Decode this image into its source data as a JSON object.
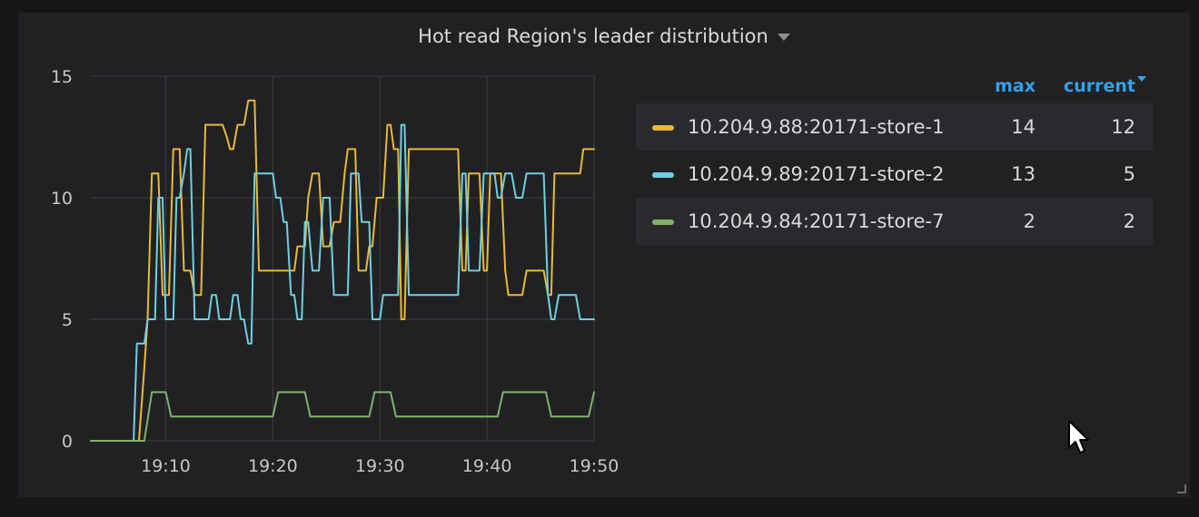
{
  "panel": {
    "title": "Hot read Region's leader distribution"
  },
  "legend": {
    "columns": {
      "max": "max",
      "current": "current"
    },
    "rows": [
      {
        "name": "10.204.9.88:20171-store-1",
        "max": "14",
        "current": "12",
        "color": "#eab839"
      },
      {
        "name": "10.204.9.89:20171-store-2",
        "max": "13",
        "current": "5",
        "color": "#6ed0e0"
      },
      {
        "name": "10.204.9.84:20171-store-7",
        "max": "2",
        "current": "2",
        "color": "#7eb26d"
      }
    ]
  },
  "chart_data": {
    "type": "line",
    "x_unit": "minutes (19:xx)",
    "xlim": [
      3,
      50
    ],
    "ylim": [
      0,
      15
    ],
    "x_ticks": [
      {
        "value": 10,
        "label": "19:10"
      },
      {
        "value": 20,
        "label": "19:20"
      },
      {
        "value": 30,
        "label": "19:30"
      },
      {
        "value": 40,
        "label": "19:40"
      },
      {
        "value": 50,
        "label": "19:50"
      }
    ],
    "y_ticks": [
      {
        "value": 0,
        "label": "0"
      },
      {
        "value": 5,
        "label": "5"
      },
      {
        "value": 10,
        "label": "10"
      },
      {
        "value": 15,
        "label": "15"
      }
    ],
    "grid": true,
    "series": [
      {
        "name": "10.204.9.88:20171-store-1",
        "color": "#eab839",
        "points": [
          [
            3,
            0
          ],
          [
            7,
            0
          ],
          [
            7.5,
            0
          ],
          [
            8,
            3
          ],
          [
            8.3,
            5
          ],
          [
            8.7,
            11
          ],
          [
            9,
            11
          ],
          [
            9.3,
            11
          ],
          [
            9.7,
            6
          ],
          [
            10,
            6
          ],
          [
            10.3,
            6
          ],
          [
            10.7,
            12
          ],
          [
            11,
            12
          ],
          [
            11.3,
            12
          ],
          [
            11.7,
            7
          ],
          [
            12,
            7
          ],
          [
            12.3,
            7
          ],
          [
            12.7,
            6
          ],
          [
            13,
            6
          ],
          [
            13.3,
            6
          ],
          [
            13.7,
            13
          ],
          [
            14,
            13
          ],
          [
            14.3,
            13
          ],
          [
            14.7,
            13
          ],
          [
            15,
            13
          ],
          [
            15.3,
            13
          ],
          [
            15.7,
            12.5
          ],
          [
            16,
            12
          ],
          [
            16.3,
            12
          ],
          [
            16.7,
            13
          ],
          [
            17,
            13
          ],
          [
            17.3,
            13
          ],
          [
            17.7,
            14
          ],
          [
            18,
            14
          ],
          [
            18.3,
            14
          ],
          [
            18.7,
            7
          ],
          [
            19,
            7
          ],
          [
            19.3,
            7
          ],
          [
            19.7,
            7
          ],
          [
            20,
            7
          ],
          [
            20.3,
            7
          ],
          [
            20.7,
            7
          ],
          [
            21,
            7
          ],
          [
            21.3,
            7
          ],
          [
            21.7,
            7
          ],
          [
            22,
            7
          ],
          [
            22.3,
            8
          ],
          [
            22.7,
            8
          ],
          [
            23,
            8
          ],
          [
            23.3,
            10
          ],
          [
            23.7,
            11
          ],
          [
            24,
            11
          ],
          [
            24.3,
            11
          ],
          [
            24.7,
            8
          ],
          [
            25,
            8
          ],
          [
            25.3,
            8
          ],
          [
            25.7,
            9
          ],
          [
            26,
            9
          ],
          [
            26.3,
            9
          ],
          [
            26.7,
            11
          ],
          [
            27,
            12
          ],
          [
            27.3,
            12
          ],
          [
            27.7,
            12
          ],
          [
            28,
            7
          ],
          [
            28.3,
            7
          ],
          [
            28.7,
            7
          ],
          [
            29,
            8
          ],
          [
            29.3,
            8
          ],
          [
            29.7,
            10
          ],
          [
            30,
            10
          ],
          [
            30.3,
            10
          ],
          [
            30.7,
            13
          ],
          [
            31,
            13
          ],
          [
            31.3,
            12
          ],
          [
            31.7,
            12
          ],
          [
            32,
            5
          ],
          [
            32.3,
            5
          ],
          [
            32.7,
            12
          ],
          [
            33,
            12
          ],
          [
            33.3,
            12
          ],
          [
            33.7,
            12
          ],
          [
            34,
            12
          ],
          [
            34.3,
            12
          ],
          [
            34.7,
            12
          ],
          [
            35,
            12
          ],
          [
            35.3,
            12
          ],
          [
            35.7,
            12
          ],
          [
            36,
            12
          ],
          [
            36.3,
            12
          ],
          [
            36.7,
            12
          ],
          [
            37,
            12
          ],
          [
            37.3,
            12
          ],
          [
            37.7,
            7
          ],
          [
            38,
            7
          ],
          [
            38.3,
            11
          ],
          [
            38.7,
            11
          ],
          [
            39,
            11
          ],
          [
            39.3,
            11
          ],
          [
            39.7,
            7
          ],
          [
            40,
            7
          ],
          [
            40.3,
            11
          ],
          [
            40.7,
            11
          ],
          [
            41,
            11
          ],
          [
            41.3,
            11
          ],
          [
            41.7,
            7
          ],
          [
            42,
            6
          ],
          [
            42.3,
            6
          ],
          [
            42.7,
            6
          ],
          [
            43,
            6
          ],
          [
            43.3,
            6
          ],
          [
            43.7,
            7
          ],
          [
            44,
            7
          ],
          [
            44.3,
            7
          ],
          [
            44.7,
            7
          ],
          [
            45,
            7
          ],
          [
            45.3,
            7
          ],
          [
            45.7,
            6
          ],
          [
            46,
            6
          ],
          [
            46.3,
            11
          ],
          [
            46.7,
            11
          ],
          [
            47,
            11
          ],
          [
            47.3,
            11
          ],
          [
            47.7,
            11
          ],
          [
            48,
            11
          ],
          [
            48.3,
            11
          ],
          [
            48.7,
            11
          ],
          [
            49,
            12
          ],
          [
            49.3,
            12
          ],
          [
            49.7,
            12
          ],
          [
            50,
            12
          ]
        ]
      },
      {
        "name": "10.204.9.89:20171-store-2",
        "color": "#6ed0e0",
        "points": [
          [
            3,
            0
          ],
          [
            7,
            0
          ],
          [
            7.3,
            4
          ],
          [
            7.7,
            4
          ],
          [
            8,
            4
          ],
          [
            8.3,
            5
          ],
          [
            8.7,
            5
          ],
          [
            9,
            5
          ],
          [
            9.3,
            10
          ],
          [
            9.7,
            10
          ],
          [
            10,
            5
          ],
          [
            10.3,
            5
          ],
          [
            10.7,
            5
          ],
          [
            11,
            10
          ],
          [
            11.3,
            10
          ],
          [
            11.7,
            11
          ],
          [
            12,
            12
          ],
          [
            12.3,
            12
          ],
          [
            12.7,
            5
          ],
          [
            13,
            5
          ],
          [
            13.3,
            5
          ],
          [
            13.7,
            5
          ],
          [
            14,
            5
          ],
          [
            14.3,
            6
          ],
          [
            14.7,
            6
          ],
          [
            15,
            5
          ],
          [
            15.3,
            5
          ],
          [
            15.7,
            5
          ],
          [
            16,
            5
          ],
          [
            16.3,
            6
          ],
          [
            16.7,
            6
          ],
          [
            17,
            5
          ],
          [
            17.3,
            5
          ],
          [
            17.7,
            4
          ],
          [
            18,
            4
          ],
          [
            18.3,
            11
          ],
          [
            18.7,
            11
          ],
          [
            19,
            11
          ],
          [
            19.3,
            11
          ],
          [
            19.7,
            11
          ],
          [
            20,
            11
          ],
          [
            20.3,
            10
          ],
          [
            20.7,
            10
          ],
          [
            21,
            9
          ],
          [
            21.3,
            9
          ],
          [
            21.7,
            6
          ],
          [
            22,
            6
          ],
          [
            22.3,
            5
          ],
          [
            22.7,
            5
          ],
          [
            23,
            9
          ],
          [
            23.3,
            9
          ],
          [
            23.7,
            7
          ],
          [
            24,
            7
          ],
          [
            24.3,
            7
          ],
          [
            24.7,
            10
          ],
          [
            25,
            10
          ],
          [
            25.3,
            10
          ],
          [
            25.7,
            6
          ],
          [
            26,
            6
          ],
          [
            26.3,
            6
          ],
          [
            26.7,
            6
          ],
          [
            27,
            6
          ],
          [
            27.3,
            11
          ],
          [
            27.7,
            11
          ],
          [
            28,
            11
          ],
          [
            28.3,
            9
          ],
          [
            28.7,
            9
          ],
          [
            29,
            9
          ],
          [
            29.3,
            5
          ],
          [
            29.7,
            5
          ],
          [
            30,
            5
          ],
          [
            30.3,
            6
          ],
          [
            30.7,
            6
          ],
          [
            31,
            6
          ],
          [
            31.3,
            6
          ],
          [
            31.7,
            6
          ],
          [
            32,
            13
          ],
          [
            32.3,
            13
          ],
          [
            32.7,
            6
          ],
          [
            33,
            6
          ],
          [
            33.3,
            6
          ],
          [
            33.7,
            6
          ],
          [
            34,
            6
          ],
          [
            34.3,
            6
          ],
          [
            34.7,
            6
          ],
          [
            35,
            6
          ],
          [
            35.3,
            6
          ],
          [
            35.7,
            6
          ],
          [
            36,
            6
          ],
          [
            36.3,
            6
          ],
          [
            36.7,
            6
          ],
          [
            37,
            6
          ],
          [
            37.3,
            6
          ],
          [
            37.7,
            11
          ],
          [
            38,
            11
          ],
          [
            38.3,
            7
          ],
          [
            38.7,
            7
          ],
          [
            39,
            7
          ],
          [
            39.3,
            7
          ],
          [
            39.7,
            11
          ],
          [
            40,
            11
          ],
          [
            40.3,
            11
          ],
          [
            40.7,
            11
          ],
          [
            41,
            10
          ],
          [
            41.3,
            10
          ],
          [
            41.7,
            11
          ],
          [
            42,
            11
          ],
          [
            42.3,
            11
          ],
          [
            42.7,
            10
          ],
          [
            43,
            10
          ],
          [
            43.3,
            10
          ],
          [
            43.7,
            11
          ],
          [
            44,
            11
          ],
          [
            44.3,
            11
          ],
          [
            44.7,
            11
          ],
          [
            45,
            11
          ],
          [
            45.3,
            11
          ],
          [
            45.7,
            6
          ],
          [
            46,
            5
          ],
          [
            46.3,
            5
          ],
          [
            46.7,
            6
          ],
          [
            47,
            6
          ],
          [
            47.3,
            6
          ],
          [
            47.7,
            6
          ],
          [
            48,
            6
          ],
          [
            48.3,
            6
          ],
          [
            48.7,
            5
          ],
          [
            49,
            5
          ],
          [
            49.3,
            5
          ],
          [
            49.7,
            5
          ],
          [
            50,
            5
          ]
        ]
      },
      {
        "name": "10.204.9.84:20171-store-7",
        "color": "#7eb26d",
        "points": [
          [
            3,
            0
          ],
          [
            7.5,
            0
          ],
          [
            8,
            0
          ],
          [
            8.7,
            2
          ],
          [
            10,
            2
          ],
          [
            10.5,
            1
          ],
          [
            20,
            1
          ],
          [
            20.5,
            2
          ],
          [
            23,
            2
          ],
          [
            23.5,
            1
          ],
          [
            29,
            1
          ],
          [
            29.5,
            2
          ],
          [
            31,
            2
          ],
          [
            31.5,
            1
          ],
          [
            41,
            1
          ],
          [
            41.5,
            2
          ],
          [
            45.5,
            2
          ],
          [
            46,
            1
          ],
          [
            49.5,
            1
          ],
          [
            50,
            2
          ]
        ]
      }
    ]
  }
}
